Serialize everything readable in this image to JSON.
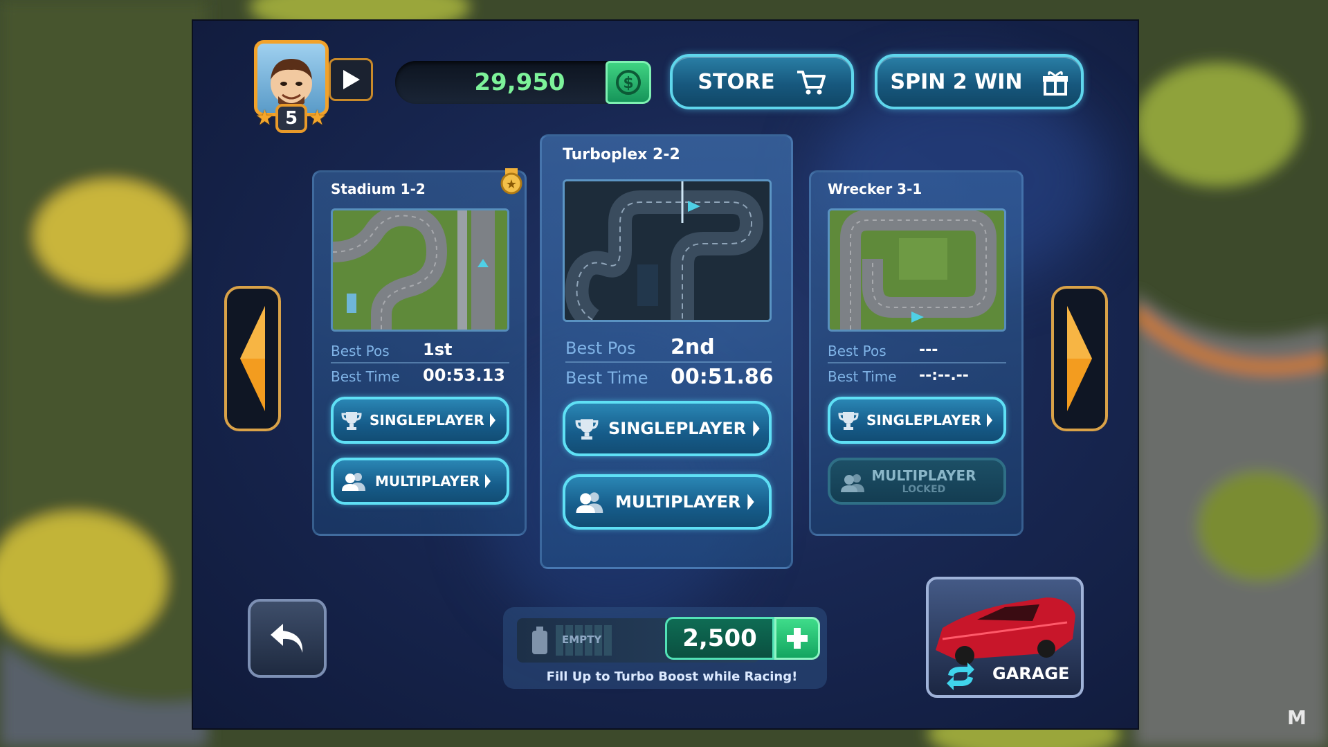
{
  "player": {
    "level": "5"
  },
  "currency": {
    "coins": "29,950"
  },
  "top_buttons": {
    "store": "STORE",
    "spin": "SPIN 2 WIN"
  },
  "tracks": [
    {
      "title": "Stadium 1-2",
      "best_pos_label": "Best Pos",
      "best_pos": "1st",
      "best_time_label": "Best Time",
      "best_time": "00:53.13",
      "singleplayer": "SINGLEPLAYER",
      "multiplayer": "MULTIPLAYER",
      "medal": true
    },
    {
      "title": "Turboplex 2-2",
      "best_pos_label": "Best Pos",
      "best_pos": "2nd",
      "best_time_label": "Best Time",
      "best_time": "00:51.86",
      "singleplayer": "SINGLEPLAYER",
      "multiplayer": "MULTIPLAYER"
    },
    {
      "title": "Wrecker 3-1",
      "best_pos_label": "Best Pos",
      "best_pos": "---",
      "best_time_label": "Best Time",
      "best_time": "--:--.--",
      "singleplayer": "SINGLEPLAYER",
      "multiplayer": "MULTIPLAYER",
      "multiplayer_status": "LOCKED"
    }
  ],
  "fuel": {
    "status": "EMPTY",
    "price": "2,500",
    "hint": "Fill Up to Turbo Boost while Racing!"
  },
  "garage": {
    "label": "GARAGE"
  },
  "watermark": "M",
  "colors": {
    "accent_cyan": "#5fe0f5",
    "coins_green": "#7df29a",
    "arrow_orange": "#f39c1f",
    "frame_blue": "#182752"
  },
  "icons": [
    "play-icon",
    "coin-icon",
    "cart-icon",
    "gift-icon",
    "trophy-icon",
    "players-icon",
    "chevron-right-icon",
    "arrow-left-icon",
    "arrow-right-icon",
    "undo-icon",
    "fuel-can-icon",
    "plus-icon",
    "refresh-icon",
    "medal-icon",
    "star-icon"
  ]
}
